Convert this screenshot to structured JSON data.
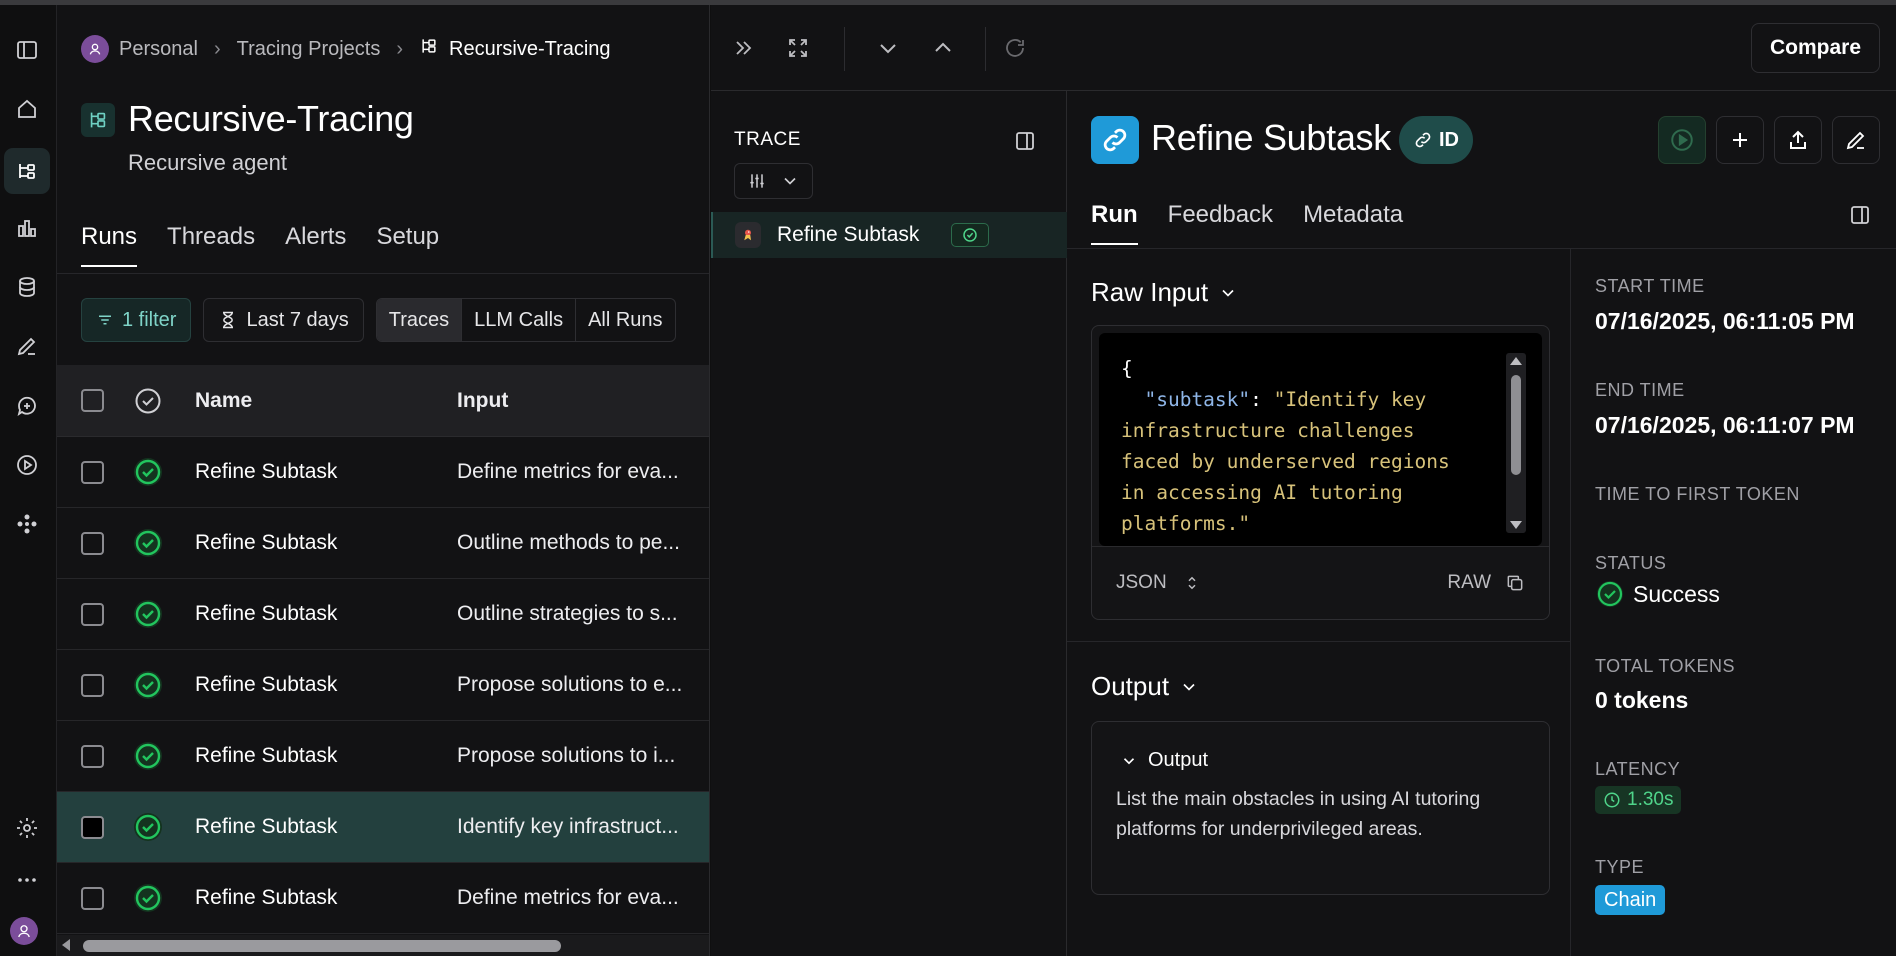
{
  "breadcrumb": {
    "items": [
      "Personal",
      "Tracing Projects",
      "Recursive-Tracing"
    ]
  },
  "project": {
    "title": "Recursive-Tracing",
    "subtitle": "Recursive agent"
  },
  "tabs": [
    "Runs",
    "Threads",
    "Alerts",
    "Setup"
  ],
  "filters": {
    "filter_label": "1 filter",
    "time_label": "Last 7 days",
    "segments": [
      "Traces",
      "LLM Calls",
      "All Runs"
    ]
  },
  "table": {
    "columns": [
      "Name",
      "Input"
    ],
    "rows": [
      {
        "name": "Refine Subtask",
        "input": "Define metrics for eva..."
      },
      {
        "name": "Refine Subtask",
        "input": "Outline methods to pe..."
      },
      {
        "name": "Refine Subtask",
        "input": "Outline strategies to s..."
      },
      {
        "name": "Refine Subtask",
        "input": "Propose solutions to e..."
      },
      {
        "name": "Refine Subtask",
        "input": "Propose solutions to i..."
      },
      {
        "name": "Refine Subtask",
        "input": "Identify key infrastruct..."
      },
      {
        "name": "Refine Subtask",
        "input": "Define metrics for eva..."
      }
    ],
    "selected_row": 5
  },
  "toolbar": {
    "compare_label": "Compare"
  },
  "trace": {
    "title": "TRACE",
    "item_label": "Refine Subtask"
  },
  "detail": {
    "title": "Refine Subtask",
    "id_label": "ID",
    "tabs": [
      "Run",
      "Feedback",
      "Metadata"
    ],
    "raw_input": {
      "title": "Raw Input",
      "open_brace": "{",
      "key": "\"subtask\"",
      "colon": ": ",
      "value_lines": [
        "\"Identify key",
        "infrastructure challenges",
        "faced by underserved regions",
        "in accessing AI tutoring",
        "platforms.\""
      ],
      "format_label": "JSON",
      "raw_label": "RAW"
    },
    "output": {
      "title": "Output",
      "inner_title": "Output",
      "text": "List the main obstacles in using AI tutoring platforms for underprivileged areas."
    },
    "meta": {
      "start_time_label": "START TIME",
      "start_time": "07/16/2025, 06:11:05 PM",
      "end_time_label": "END TIME",
      "end_time": "07/16/2025, 06:11:07 PM",
      "ttft_label": "TIME TO FIRST TOKEN",
      "status_label": "STATUS",
      "status": "Success",
      "tokens_label": "TOTAL TOKENS",
      "tokens": "0 tokens",
      "latency_label": "LATENCY",
      "latency": "1.30s",
      "type_label": "TYPE",
      "type": "Chain"
    }
  },
  "colors": {
    "success": "#22c55e",
    "accent_teal": "#23403e",
    "chain_blue": "#1f9ad8"
  }
}
